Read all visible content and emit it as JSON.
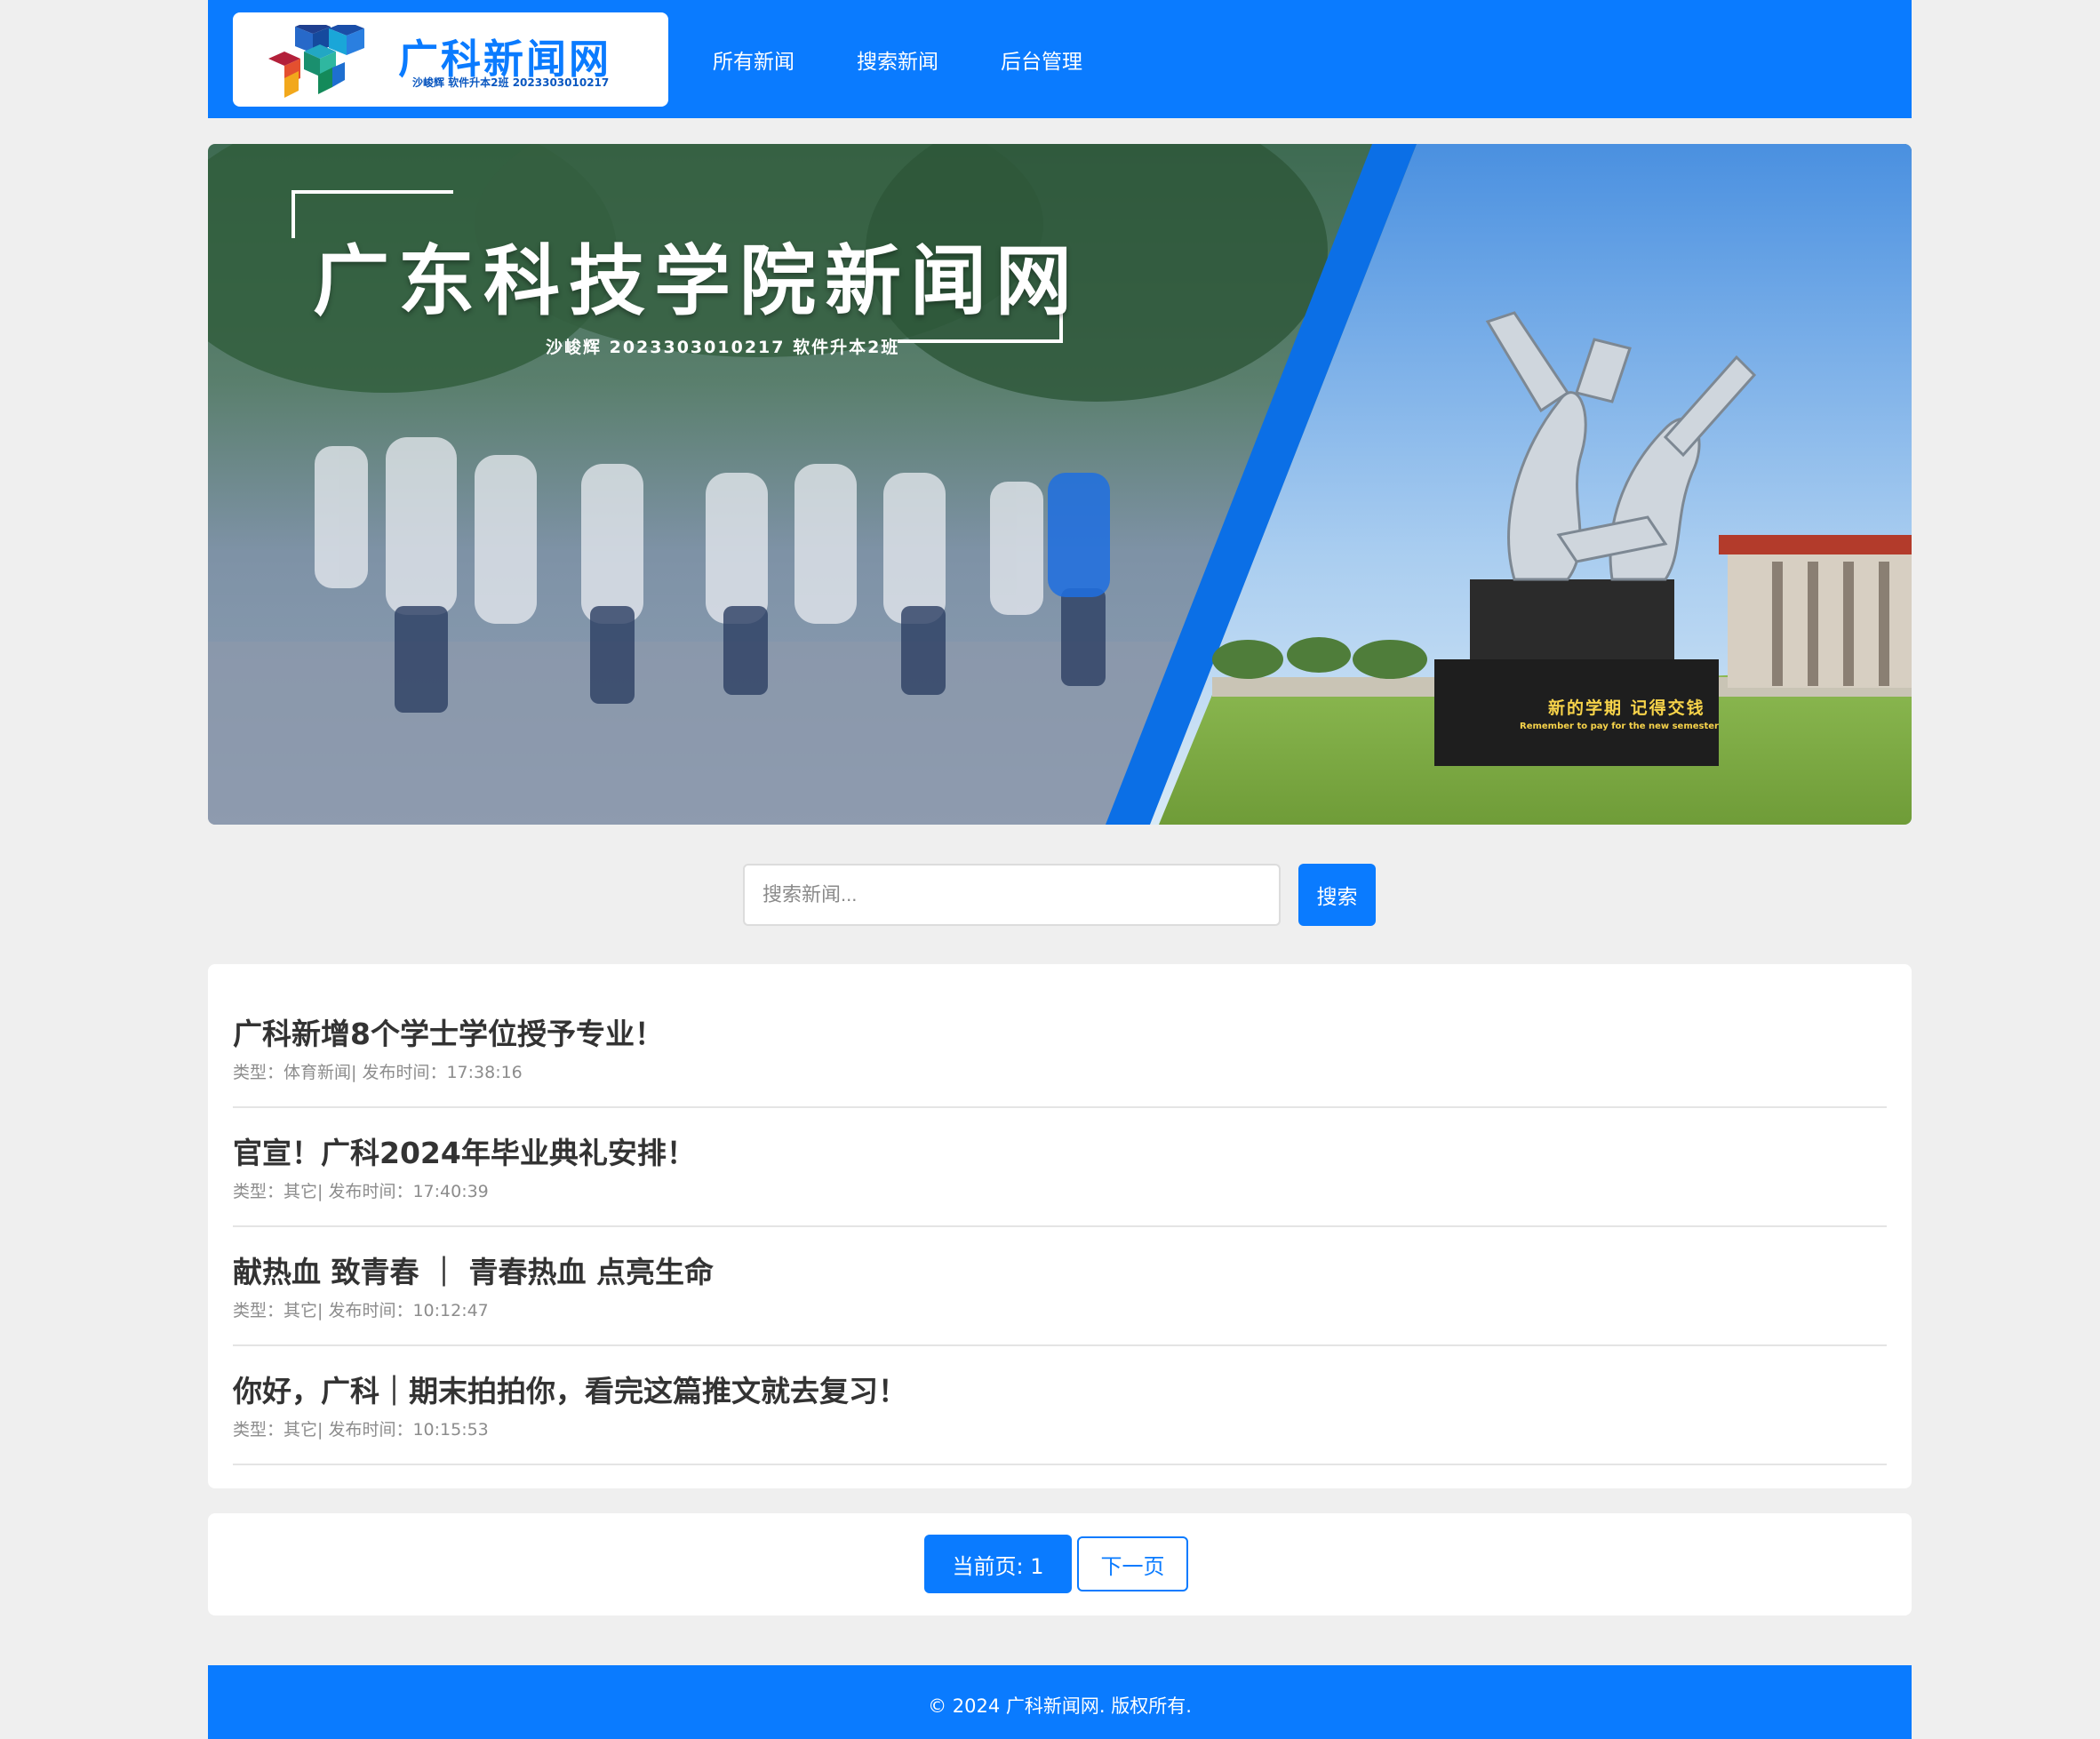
{
  "header": {
    "logo_title": "广科新闻网",
    "logo_subtitle": "沙峻辉 软件升本2班 2023303010217",
    "nav": [
      "所有新闻",
      "搜索新闻",
      "后台管理"
    ],
    "brand_color": "#0a7bff"
  },
  "banner": {
    "title": "广东科技学院新闻网",
    "subtitle": "沙峻辉 2023303010217 软件升本2班",
    "plaque_text": "新的学期 记得交钱",
    "plaque_subtext": "Remember to pay for the new semester"
  },
  "search": {
    "placeholder": "搜索新闻...",
    "button_label": "搜索"
  },
  "news": [
    {
      "title": "广科新增8个学士学位授予专业！",
      "meta": "类型：体育新闻| 发布时间：17:38:16"
    },
    {
      "title": "官宣！广科2024年毕业典礼安排！",
      "meta": "类型：其它| 发布时间：17:40:39"
    },
    {
      "title": "献热血 致青春 ｜ 青春热血 点亮生命",
      "meta": "类型：其它| 发布时间：10:12:47"
    },
    {
      "title": "你好，广科｜期末拍拍你，看完这篇推文就去复习！",
      "meta": "类型：其它| 发布时间：10:15:53"
    }
  ],
  "pagination": {
    "current_label": "当前页: 1",
    "next_label": "下一页"
  },
  "footer": {
    "text": "© 2024 广科新闻网. 版权所有."
  }
}
